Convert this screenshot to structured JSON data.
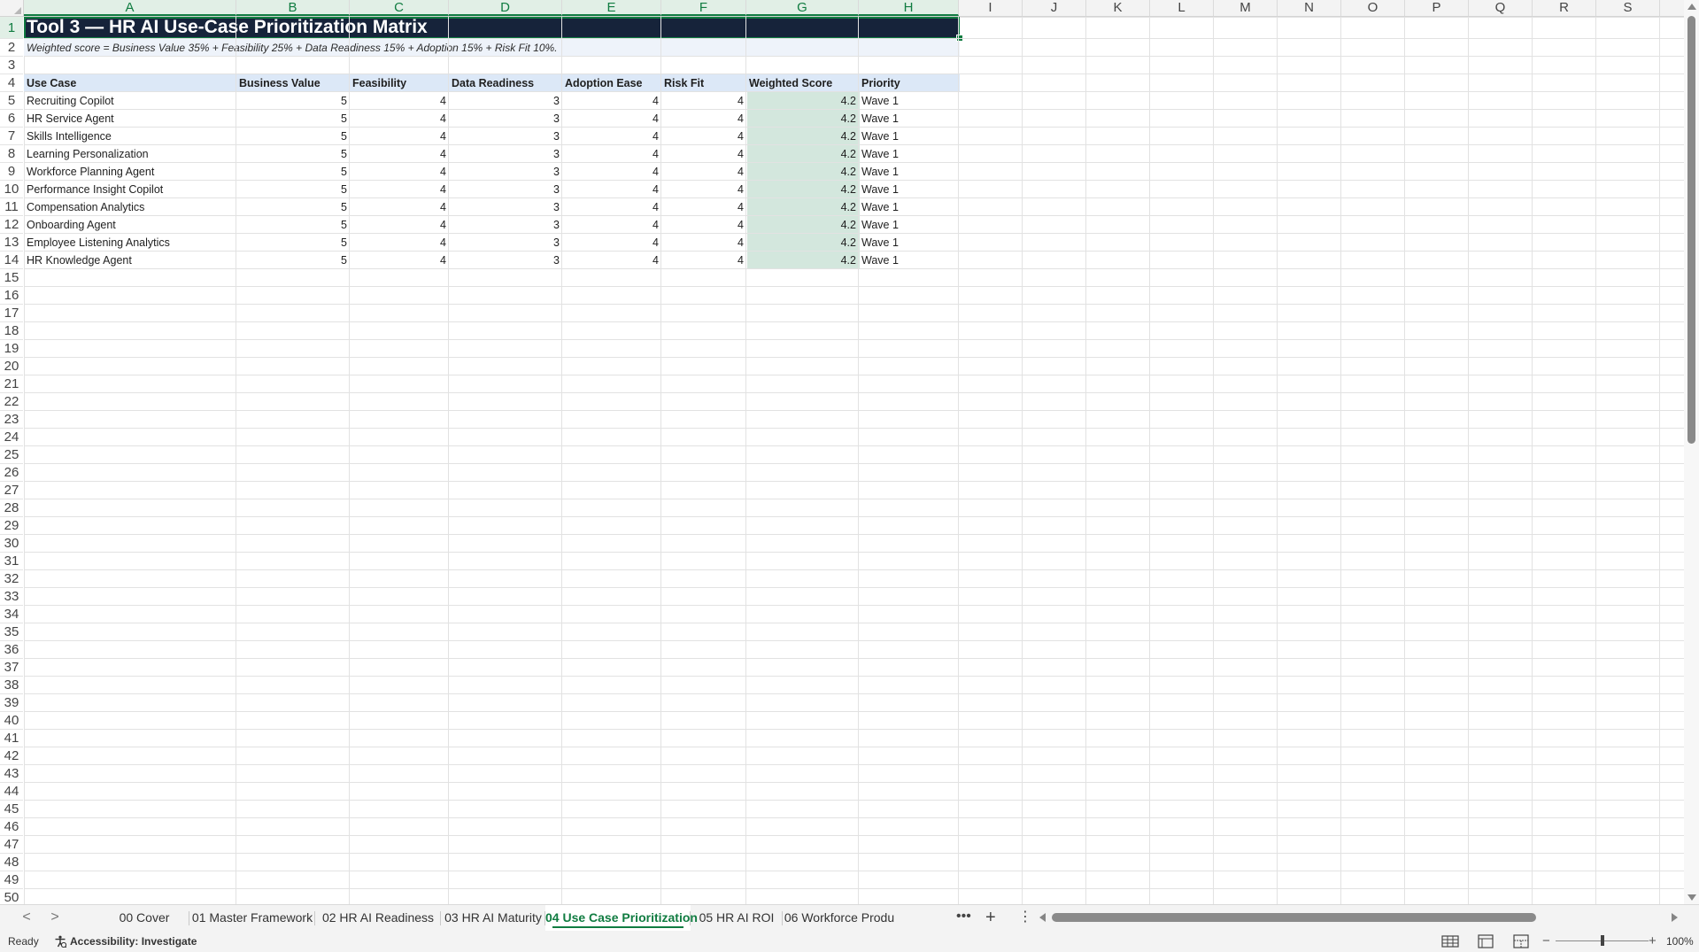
{
  "sheet": {
    "columns": [
      "A",
      "B",
      "C",
      "D",
      "E",
      "F",
      "G",
      "H",
      "I",
      "J",
      "K",
      "L",
      "M",
      "N",
      "O",
      "P",
      "Q",
      "R",
      "S"
    ],
    "row_count": 50,
    "title": "Tool 3 — HR AI Use-Case Prioritization Matrix",
    "note": "Weighted score = Business Value 35% + Feasibility 25% + Data Readiness 15% + Adoption 15% + Risk Fit 10%.",
    "headers": [
      "Use Case",
      "Business Value",
      "Feasibility",
      "Data Readiness",
      "Adoption Ease",
      "Risk Fit",
      "Weighted Score",
      "Priority"
    ],
    "rows": [
      [
        "Recruiting Copilot",
        "5",
        "4",
        "3",
        "4",
        "4",
        "4.2",
        "Wave 1"
      ],
      [
        "HR Service Agent",
        "5",
        "4",
        "3",
        "4",
        "4",
        "4.2",
        "Wave 1"
      ],
      [
        "Skills Intelligence",
        "5",
        "4",
        "3",
        "4",
        "4",
        "4.2",
        "Wave 1"
      ],
      [
        "Learning Personalization",
        "5",
        "4",
        "3",
        "4",
        "4",
        "4.2",
        "Wave 1"
      ],
      [
        "Workforce Planning Agent",
        "5",
        "4",
        "3",
        "4",
        "4",
        "4.2",
        "Wave 1"
      ],
      [
        "Performance Insight Copilot",
        "5",
        "4",
        "3",
        "4",
        "4",
        "4.2",
        "Wave 1"
      ],
      [
        "Compensation Analytics",
        "5",
        "4",
        "3",
        "4",
        "4",
        "4.2",
        "Wave 1"
      ],
      [
        "Onboarding Agent",
        "5",
        "4",
        "3",
        "4",
        "4",
        "4.2",
        "Wave 1"
      ],
      [
        "Employee Listening Analytics",
        "5",
        "4",
        "3",
        "4",
        "4",
        "4.2",
        "Wave 1"
      ],
      [
        "HR Knowledge Agent",
        "5",
        "4",
        "3",
        "4",
        "4",
        "4.2",
        "Wave 1"
      ]
    ],
    "colors": {
      "title_fill": "#16233a",
      "note_fill": "#eef3fa",
      "header_fill": "#dce8f7",
      "score_fill": "#d3e7dd",
      "selection": "#107c41"
    }
  },
  "tabs": {
    "items": [
      "00 Cover",
      "01 Master Framework",
      "02 HR AI Readiness",
      "03 HR AI Maturity",
      "04 Use Case Prioritization",
      "05 HR AI ROI",
      "06 Workforce Produ"
    ],
    "active_index": 4,
    "more": "•••",
    "add": "+",
    "options": "⋮",
    "prev": "<",
    "next": ">"
  },
  "status": {
    "ready": "Ready",
    "accessibility": "Accessibility: Investigate",
    "zoom_minus": "−",
    "zoom_plus": "+",
    "zoom": "100%",
    "zoom_level_fraction": 0.5
  }
}
